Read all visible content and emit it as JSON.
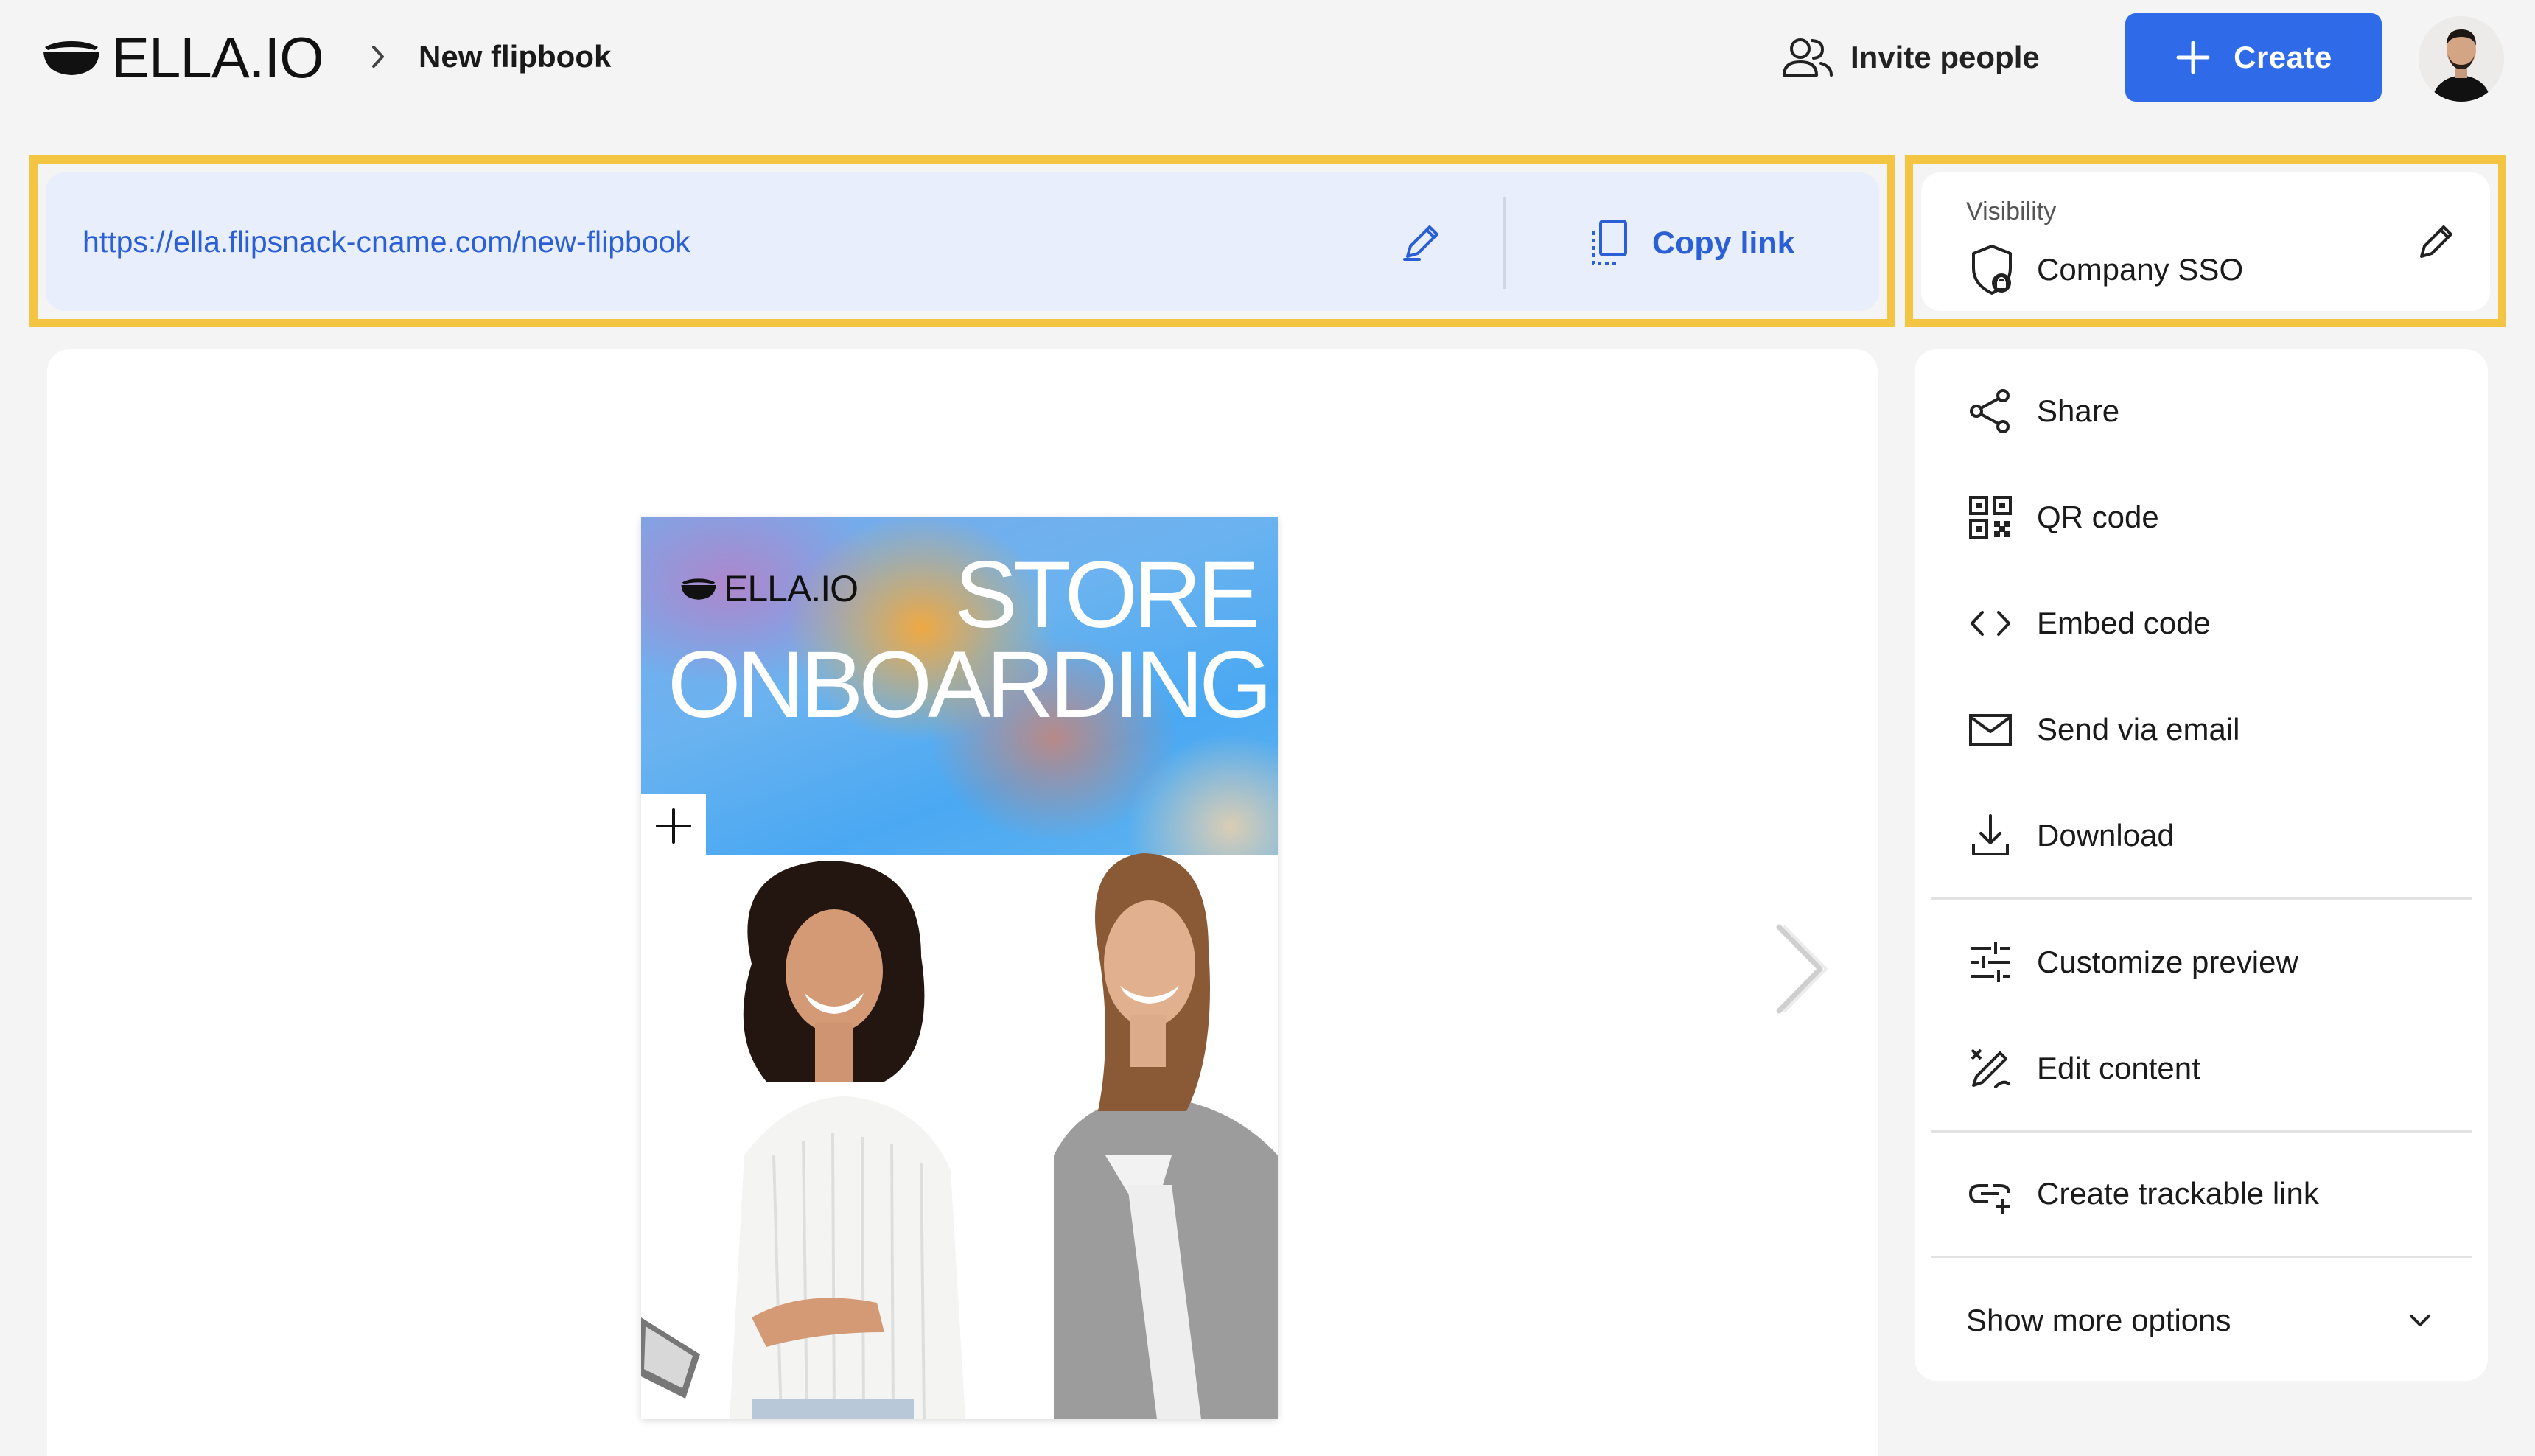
{
  "header": {
    "logo_text": "ELLA.IO",
    "breadcrumb_title": "New flipbook",
    "invite_label": "Invite people",
    "create_label": "Create"
  },
  "link_bar": {
    "url": "https://ella.flipsnack-cname.com/new-flipbook",
    "copy_label": "Copy link"
  },
  "visibility": {
    "label": "Visibility",
    "value": "Company SSO"
  },
  "cover": {
    "logo_text": "ELLA.IO",
    "title_line1": "STORE",
    "title_line2": "ONBOARDING"
  },
  "menu": {
    "items": [
      {
        "label": "Share",
        "icon": "share-icon"
      },
      {
        "label": "QR code",
        "icon": "qr-code-icon"
      },
      {
        "label": "Embed code",
        "icon": "code-icon"
      },
      {
        "label": "Send via email",
        "icon": "mail-icon"
      },
      {
        "label": "Download",
        "icon": "download-icon"
      },
      {
        "label": "Customize preview",
        "icon": "sliders-icon"
      },
      {
        "label": "Edit content",
        "icon": "edit-content-icon"
      },
      {
        "label": "Create trackable link",
        "icon": "link-add-icon"
      }
    ],
    "more_label": "Show more options"
  },
  "colors": {
    "accent": "#2f6ae8",
    "highlight": "#f4c542",
    "link_bg": "#e8eefb"
  }
}
